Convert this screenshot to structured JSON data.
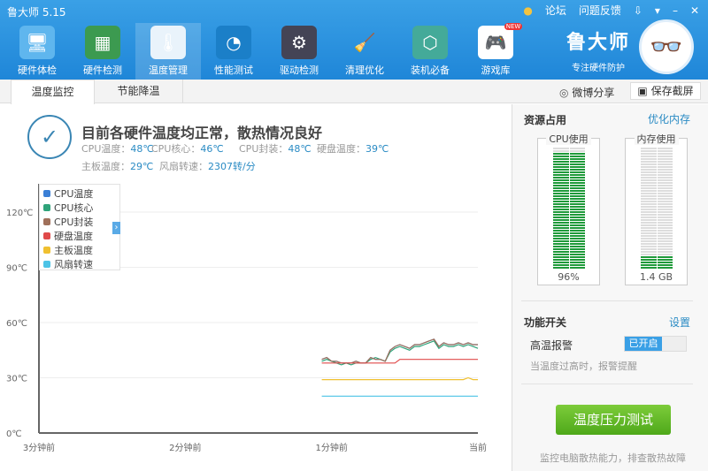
{
  "app": {
    "title": "鲁大师 5.15",
    "links": [
      "论坛",
      "问题反馈"
    ],
    "window_controls": [
      "download-icon",
      "menu-icon",
      "minimize-icon",
      "close-icon"
    ]
  },
  "nav": [
    {
      "label": "硬件体检",
      "icon": "monitor-icon"
    },
    {
      "label": "硬件检测",
      "icon": "graphics-card-icon"
    },
    {
      "label": "温度管理",
      "icon": "thermometer-icon",
      "active": true
    },
    {
      "label": "性能测试",
      "icon": "speedometer-icon"
    },
    {
      "label": "驱动检测",
      "icon": "gear-icon"
    },
    {
      "label": "清理优化",
      "icon": "broom-icon"
    },
    {
      "label": "装机必备",
      "icon": "box-icon"
    },
    {
      "label": "游戏库",
      "icon": "gamepad-icon",
      "badge": "NEW"
    }
  ],
  "brand": {
    "name": "鲁大师",
    "slogan": "专注硬件防护"
  },
  "tabs": [
    {
      "label": "温度监控",
      "active": true
    },
    {
      "label": "节能降温"
    }
  ],
  "actions": {
    "share": "微博分享",
    "screenshot": "保存截屏"
  },
  "status": {
    "headline": "目前各硬件温度均正常，散热情况良好",
    "items": [
      {
        "label": "CPU温度：",
        "value": "48℃"
      },
      {
        "label": "CPU核心：",
        "value": "46℃"
      },
      {
        "label": "CPU封装：",
        "value": "48℃"
      },
      {
        "label": "硬盘温度：",
        "value": "39℃"
      },
      {
        "label": "主板温度：",
        "value": "29℃"
      },
      {
        "label": "风扇转速：",
        "value": "2307转/分"
      }
    ]
  },
  "chart_data": {
    "type": "line",
    "ylim": [
      0,
      120
    ],
    "yticks": [
      "0℃",
      "30℃",
      "60℃",
      "90℃",
      "120℃"
    ],
    "xticks": [
      "3分钟前",
      "2分钟前",
      "1分钟前",
      "当前"
    ],
    "grid": true,
    "legend": "top-left",
    "x_seconds_ago": [
      64,
      62,
      60,
      58,
      56,
      54,
      52,
      50,
      48,
      46,
      44,
      42,
      40,
      38,
      36,
      34,
      32,
      30,
      28,
      26,
      24,
      22,
      20,
      18,
      16,
      14,
      12,
      10,
      8,
      6,
      4,
      2,
      0
    ],
    "series": [
      {
        "name": "CPU温度",
        "color": "#3b7fd6",
        "values": [
          40,
          41,
          39,
          39,
          38,
          38,
          38,
          39,
          38,
          38,
          41,
          40,
          40,
          39,
          45,
          47,
          48,
          47,
          46,
          48,
          48,
          49,
          50,
          51,
          47,
          49,
          48,
          48,
          49,
          48,
          49,
          48,
          48
        ]
      },
      {
        "name": "CPU核心",
        "color": "#2fa37a",
        "values": [
          39,
          40,
          39,
          38,
          37,
          38,
          37,
          38,
          38,
          38,
          40,
          41,
          40,
          39,
          44,
          46,
          47,
          46,
          45,
          47,
          47,
          48,
          49,
          50,
          46,
          48,
          47,
          47,
          48,
          47,
          48,
          47,
          46
        ]
      },
      {
        "name": "CPU封装",
        "color": "#a0705a",
        "values": [
          40,
          41,
          39,
          39,
          38,
          38,
          38,
          39,
          38,
          38,
          41,
          40,
          40,
          39,
          45,
          47,
          48,
          47,
          46,
          48,
          48,
          49,
          50,
          51,
          47,
          49,
          48,
          48,
          49,
          48,
          49,
          48,
          48
        ]
      },
      {
        "name": "硬盘温度",
        "color": "#e04a4a",
        "values": [
          38,
          38,
          38,
          38,
          38,
          38,
          38,
          38,
          38,
          38,
          38,
          38,
          38,
          38,
          38,
          38,
          40,
          40,
          40,
          40,
          40,
          40,
          40,
          40,
          40,
          40,
          40,
          40,
          40,
          40,
          40,
          40,
          40
        ]
      },
      {
        "name": "主板温度",
        "color": "#f0c030",
        "values": [
          29,
          29,
          29,
          29,
          29,
          29,
          29,
          29,
          29,
          29,
          29,
          29,
          29,
          29,
          29,
          29,
          29,
          29,
          29,
          29,
          29,
          29,
          29,
          29,
          29,
          29,
          29,
          29,
          29,
          29,
          30,
          29,
          29
        ]
      },
      {
        "name": "风扇转速",
        "color": "#4cc3e6",
        "values": [
          20,
          20,
          20,
          20,
          20,
          20,
          20,
          20,
          20,
          20,
          20,
          20,
          20,
          20,
          20,
          20,
          20,
          20,
          20,
          20,
          20,
          20,
          20,
          20,
          20,
          20,
          20,
          20,
          20,
          20,
          20,
          20,
          20
        ]
      }
    ]
  },
  "side": {
    "title": "资源占用",
    "optimize": "优化内存",
    "cpu": {
      "label": "CPU使用",
      "value": "96%",
      "percent": 96
    },
    "mem": {
      "label": "内存使用",
      "value": "1.4 GB",
      "percent": 11
    },
    "switch_title": "功能开关",
    "settings": "设置",
    "alarm": {
      "label": "高温报警",
      "state": "已开启",
      "on": true,
      "desc": "当温度过高时，报警提醒"
    },
    "stress_button": "温度压力测试",
    "stress_desc": "监控电脑散热能力，排查散热故障"
  }
}
